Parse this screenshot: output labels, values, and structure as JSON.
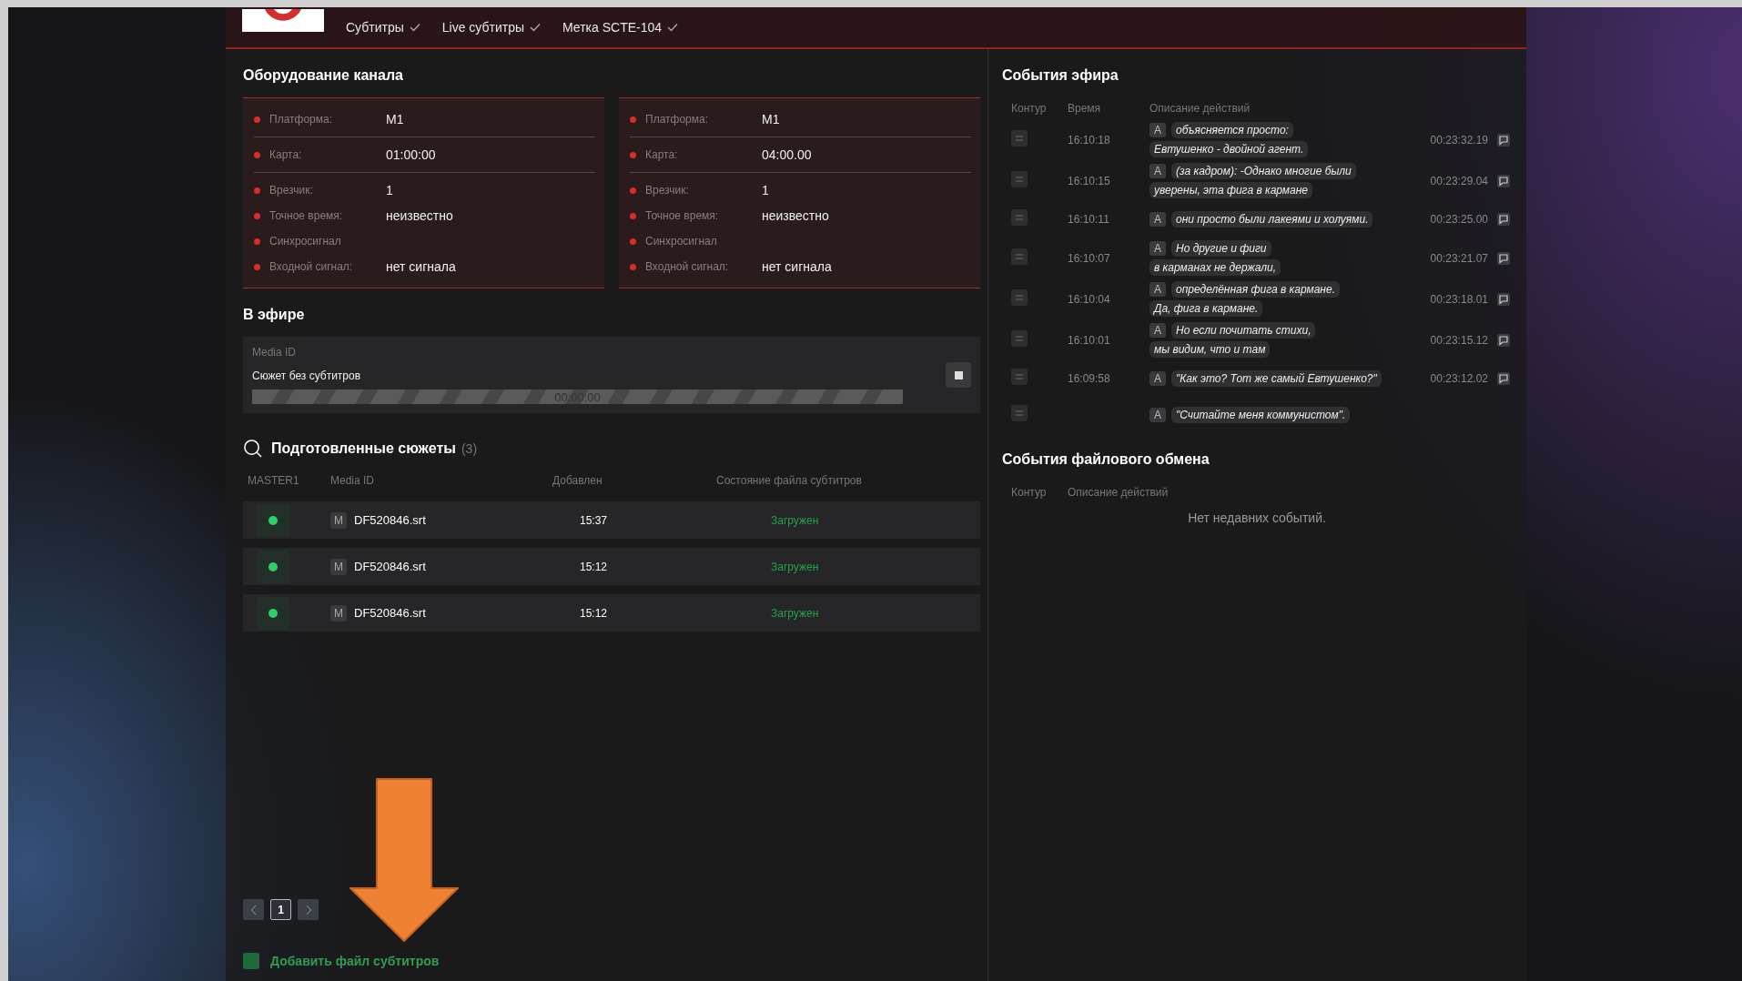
{
  "header": {
    "tabs": [
      {
        "label": "Субтитры",
        "checked": true
      },
      {
        "label": "Live субтитры",
        "checked": true
      },
      {
        "label": "Метка SCTE-104",
        "checked": true
      }
    ]
  },
  "equipment": {
    "title": "Оборудование канала",
    "panels": [
      {
        "groups": [
          [
            {
              "label": "Платформа:",
              "value": "M1"
            }
          ],
          [
            {
              "label": "Карта:",
              "value": "01:00:00"
            }
          ],
          [
            {
              "label": "Врезчик:",
              "value": "1"
            },
            {
              "label": "Точное время:",
              "value": "неизвестно"
            },
            {
              "label": "Синхросигнал"
            },
            {
              "label": "Входной сигнал:",
              "value": "нет сигнала"
            }
          ]
        ]
      },
      {
        "groups": [
          [
            {
              "label": "Платформа:",
              "value": "M1"
            }
          ],
          [
            {
              "label": "Карта:",
              "value": "04:00.00"
            }
          ],
          [
            {
              "label": "Врезчик:",
              "value": "1"
            },
            {
              "label": "Точное время:",
              "value": "неизвестно"
            },
            {
              "label": "Синхросигнал"
            },
            {
              "label": "Входной сигнал:",
              "value": "нет сигнала"
            }
          ]
        ]
      }
    ]
  },
  "on_air": {
    "title": "В эфире",
    "label": "Media ID",
    "name": "Сюжет без субтитров",
    "timecode": "00:00:00",
    "level": 0
  },
  "prepared": {
    "title": "Подготовленные сюжеты",
    "count": "(3)",
    "columns": [
      "MASTER1",
      "Media ID",
      "Добавлен",
      "Состояние файла субтитров"
    ],
    "rows": [
      {
        "badge": "M",
        "media_id": "DF520846.srt",
        "added": "15:37",
        "status": "Загружен"
      },
      {
        "badge": "M",
        "media_id": "DF520846.srt",
        "added": "15:12",
        "status": "Загружен"
      },
      {
        "badge": "M",
        "media_id": "DF520846.srt",
        "added": "15:12",
        "status": "Загружен"
      }
    ],
    "pages": [
      {
        "label": "1",
        "selected": true
      }
    ],
    "add_button": "Добавить файл субтитров"
  },
  "air_events": {
    "title": "События эфира",
    "columns": [
      "Контур",
      "Время",
      "Описание действий"
    ],
    "rows": [
      {
        "time": "16:10:18",
        "badge": "A",
        "lines": [
          "объясняется просто:",
          "Евтушенко - двойной агент."
        ],
        "timecode": "00:23:32.19"
      },
      {
        "time": "16:10:15",
        "badge": "A",
        "lines": [
          "(за кадром): -Однако многие были",
          "уверены, эта фига в кармане"
        ],
        "timecode": "00:23:29.04"
      },
      {
        "time": "16:10:11",
        "badge": "A",
        "lines": [
          "они просто были лакеями и холуями."
        ],
        "timecode": "00:23:25.00"
      },
      {
        "time": "16:10:07",
        "badge": "A",
        "lines": [
          "Но другие и фиги",
          "в карманах не держали,"
        ],
        "timecode": "00:23:21.07"
      },
      {
        "time": "16:10:04",
        "badge": "A",
        "lines": [
          "определённая фига в кармане.",
          "Да, фига в кармане."
        ],
        "timecode": "00:23:18.01"
      },
      {
        "time": "16:10:01",
        "badge": "A",
        "lines": [
          "Но если почитать стихи,",
          "мы видим, что и там"
        ],
        "timecode": "00:23:15.12"
      },
      {
        "time": "16:09:58",
        "badge": "A",
        "lines": [
          "\"Как это? Тот же самый Евтушенко?\""
        ],
        "timecode": "00:23:12.02"
      },
      {
        "badge": "A",
        "lines": [
          "\"Считайте меня коммунистом\"."
        ]
      }
    ]
  },
  "file_events": {
    "title": "События файлового обмена",
    "columns": [
      "Контур",
      "Описание действий"
    ],
    "empty": "Нет недавних событий."
  }
}
